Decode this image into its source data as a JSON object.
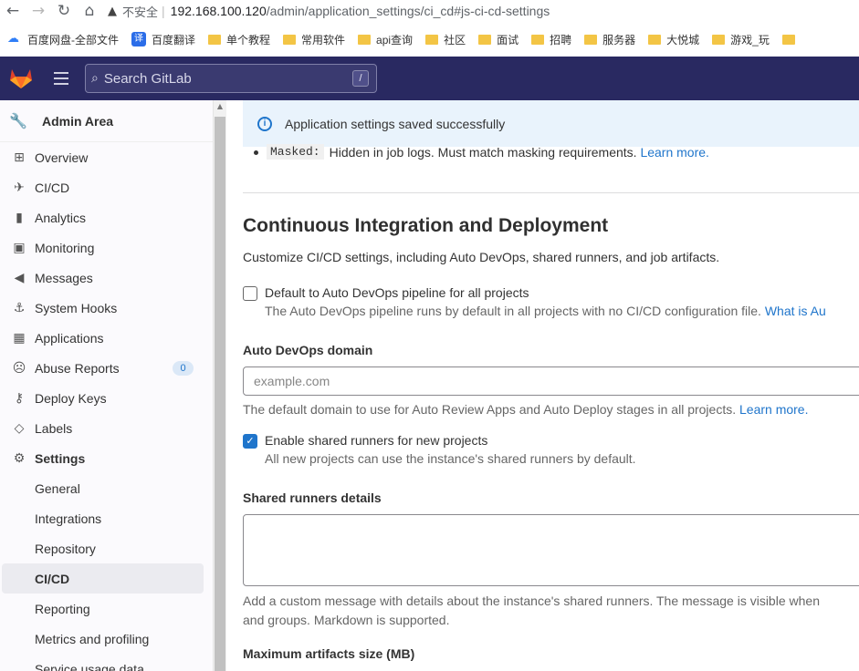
{
  "browser": {
    "back": "←",
    "forward": "→",
    "reload": "↻",
    "home": "⌂",
    "insecure": "不安全",
    "url_host": "192.168.100.120",
    "url_rest": "/admin/application_settings/ci_cd#js-ci-cd-settings"
  },
  "bookmarks": [
    {
      "label": "百度网盘-全部文件",
      "icon": "cloud-icon"
    },
    {
      "label": "百度翻译",
      "icon": "translate-icon"
    },
    {
      "label": "单个教程",
      "icon": "folder-icon"
    },
    {
      "label": "常用软件",
      "icon": "folder-icon"
    },
    {
      "label": "api查询",
      "icon": "folder-icon"
    },
    {
      "label": "社区",
      "icon": "folder-icon"
    },
    {
      "label": "面试",
      "icon": "folder-icon"
    },
    {
      "label": "招聘",
      "icon": "folder-icon"
    },
    {
      "label": "服务器",
      "icon": "folder-icon"
    },
    {
      "label": "大悦城",
      "icon": "folder-icon"
    },
    {
      "label": "游戏_玩",
      "icon": "folder-icon"
    }
  ],
  "header": {
    "search_placeholder": "Search GitLab",
    "search_shortcut": "/"
  },
  "sidebar": {
    "title": "Admin Area",
    "items": [
      {
        "label": "Overview",
        "icon": "⊞"
      },
      {
        "label": "CI/CD",
        "icon": "✈"
      },
      {
        "label": "Analytics",
        "icon": "▮"
      },
      {
        "label": "Monitoring",
        "icon": "▣"
      },
      {
        "label": "Messages",
        "icon": "◀"
      },
      {
        "label": "System Hooks",
        "icon": "⚓"
      },
      {
        "label": "Applications",
        "icon": "▦"
      },
      {
        "label": "Abuse Reports",
        "icon": "☹",
        "badge": "0"
      },
      {
        "label": "Deploy Keys",
        "icon": "⚷"
      },
      {
        "label": "Labels",
        "icon": "◇"
      },
      {
        "label": "Settings",
        "icon": "⚙"
      }
    ],
    "settings_sub": [
      "General",
      "Integrations",
      "Repository",
      "CI/CD",
      "Reporting",
      "Metrics and profiling",
      "Service usage data"
    ]
  },
  "main": {
    "alert": "Application settings saved successfully",
    "masked_code": "Masked:",
    "masked_text": "Hidden in job logs. Must match masking requirements.",
    "masked_link": "Learn more.",
    "section_title": "Continuous Integration and Deployment",
    "section_desc": "Customize CI/CD settings, including Auto DevOps, shared runners, and job artifacts.",
    "auto_devops_label": "Default to Auto DevOps pipeline for all projects",
    "auto_devops_help": "The Auto DevOps pipeline runs by default in all projects with no CI/CD configuration file.",
    "auto_devops_link": "What is Au",
    "domain_label": "Auto DevOps domain",
    "domain_placeholder": "example.com",
    "domain_help": "The default domain to use for Auto Review Apps and Auto Deploy stages in all projects.",
    "domain_link": "Learn more.",
    "shared_runners_label": "Enable shared runners for new projects",
    "shared_runners_help": "All new projects can use the instance's shared runners by default.",
    "runner_details_label": "Shared runners details",
    "runner_details_help1": "Add a custom message with details about the instance's shared runners. The message is visible when",
    "runner_details_help2": "and groups. Markdown is supported.",
    "max_artifacts_label": "Maximum artifacts size (MB)"
  }
}
